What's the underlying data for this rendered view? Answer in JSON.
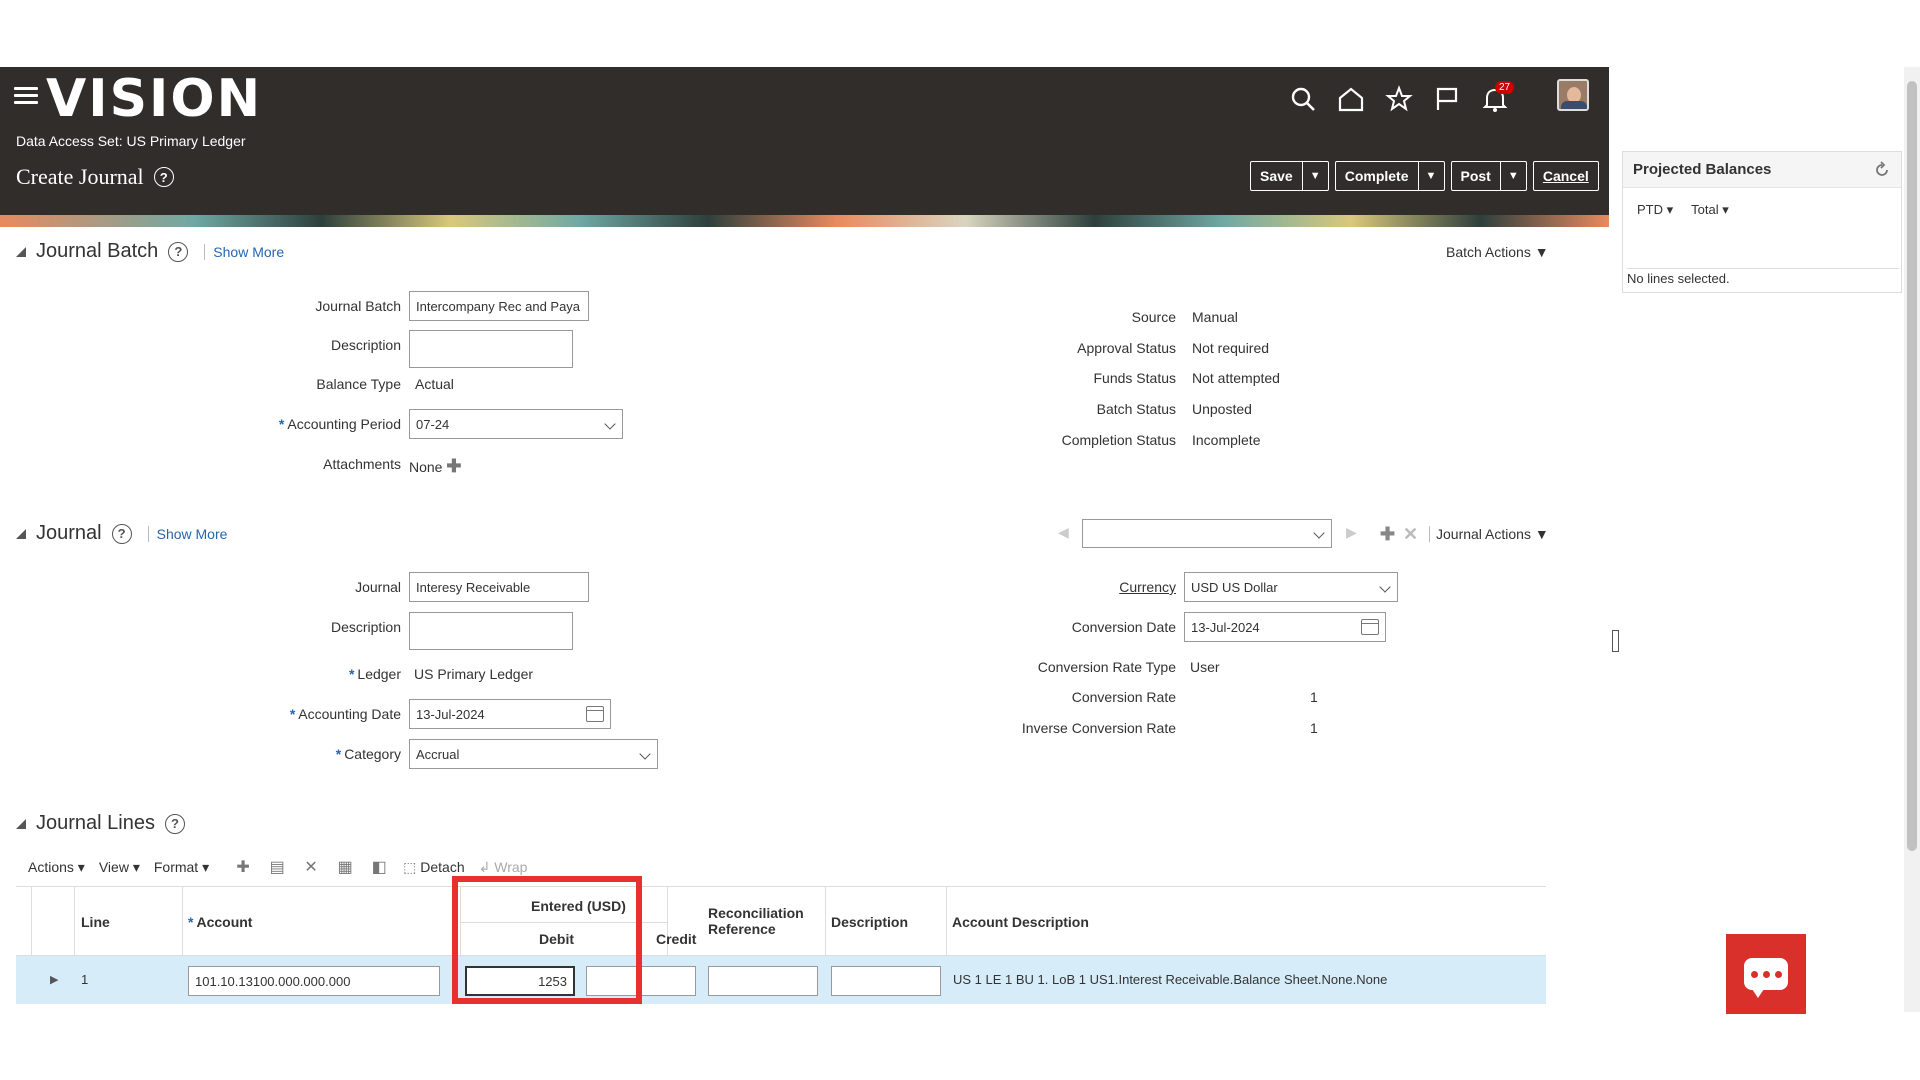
{
  "app": {
    "logo": "VISION",
    "data_access_set": "Data Access Set: US Primary Ledger",
    "page_title": "Create Journal",
    "notification_count": "27"
  },
  "buttons": {
    "save": "Save",
    "complete": "Complete",
    "post": "Post",
    "cancel": "Cancel"
  },
  "projected": {
    "title": "Projected Balances",
    "ptd": "PTD",
    "total": "Total",
    "empty": "No lines selected."
  },
  "journal_batch": {
    "title": "Journal Batch",
    "show_more": "Show More",
    "batch_actions": "Batch Actions",
    "fields": {
      "journal_batch_label": "Journal Batch",
      "journal_batch_value": "Intercompany Rec and Paya",
      "description_label": "Description",
      "balance_type_label": "Balance Type",
      "balance_type_value": "Actual",
      "accounting_period_label": "Accounting Period",
      "accounting_period_value": "07-24",
      "attachments_label": "Attachments",
      "attachments_value": "None"
    },
    "status": {
      "source_label": "Source",
      "source_value": "Manual",
      "approval_label": "Approval Status",
      "approval_value": "Not required",
      "funds_label": "Funds Status",
      "funds_value": "Not attempted",
      "batch_label": "Batch Status",
      "batch_value": "Unposted",
      "completion_label": "Completion Status",
      "completion_value": "Incomplete"
    }
  },
  "journal": {
    "title": "Journal",
    "show_more": "Show More",
    "journal_actions": "Journal Actions",
    "fields": {
      "journal_label": "Journal",
      "journal_value": "Interesy Receivable",
      "description_label": "Description",
      "ledger_label": "Ledger",
      "ledger_value": "US Primary Ledger",
      "accounting_date_label": "Accounting Date",
      "accounting_date_value": "13-Jul-2024",
      "category_label": "Category",
      "category_value": "Accrual"
    },
    "currency": {
      "currency_label": "Currency",
      "currency_value": "USD US Dollar",
      "conv_date_label": "Conversion Date",
      "conv_date_value": "13-Jul-2024",
      "rate_type_label": "Conversion Rate Type",
      "rate_type_value": "User",
      "rate_label": "Conversion Rate",
      "rate_value": "1",
      "inverse_label": "Inverse Conversion Rate",
      "inverse_value": "1"
    }
  },
  "journal_lines": {
    "title": "Journal Lines",
    "toolbar": {
      "actions": "Actions",
      "view": "View",
      "format": "Format",
      "detach": "Detach",
      "wrap": "Wrap"
    },
    "headers": {
      "line": "Line",
      "account": "Account",
      "entered": "Entered (USD)",
      "debit": "Debit",
      "credit": "Credit",
      "recon": "Reconciliation Reference",
      "description": "Description",
      "account_description": "Account Description"
    },
    "rows": [
      {
        "line": "1",
        "account": "101.10.13100.000.000.000",
        "debit": "1253",
        "credit": "",
        "recon": "",
        "description": "",
        "account_description": "US 1 LE 1 BU 1. LoB 1 US1.Interest Receivable.Balance Sheet.None.None"
      }
    ]
  }
}
